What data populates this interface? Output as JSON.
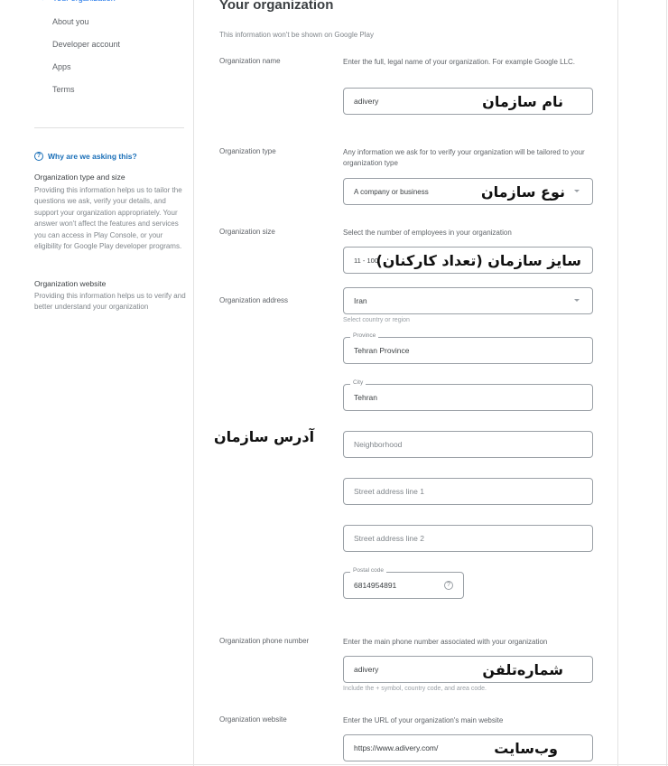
{
  "sidebar": {
    "nav": {
      "active": "Your organization",
      "items": [
        "About you",
        "Developer account",
        "Apps",
        "Terms"
      ]
    },
    "why": {
      "label": "Why are we asking this?",
      "sections": [
        {
          "heading": "Organization type and size",
          "body": "Providing this information helps us to tailor the questions we ask, verify your details, and support your organization appropriately. Your answer won't affect the features and services you can access in Play Console, or your eligibility for Google Play developer programs."
        },
        {
          "heading": "Organization website",
          "body": "Providing this information helps us to verify and better understand your organization"
        }
      ]
    }
  },
  "main": {
    "title": "Your organization",
    "subtitle": "This information won't be shown on Google Play",
    "org_name": {
      "label": "Organization name",
      "desc": "Enter the full, legal name of your organization. For example Google LLC.",
      "value": "adivery",
      "annotation": "نام سازمان"
    },
    "org_type": {
      "label": "Organization type",
      "desc": "Any information we ask for to verify your organization will be tailored to your organization type",
      "value": "A company or business",
      "annotation": "نوع سازمان"
    },
    "org_size": {
      "label": "Organization size",
      "desc": "Select the number of employees in your organization",
      "value": "11 - 100",
      "annotation": "سایز سازمان (تعداد کارکنان)"
    },
    "org_address": {
      "label": "Organization address",
      "annotation": "آدرس سازمان",
      "country": {
        "value": "Iran",
        "hint": "Select country or region"
      },
      "province": {
        "legend": "Province",
        "value": "Tehran Province"
      },
      "city": {
        "legend": "City",
        "value": "Tehran"
      },
      "neighborhood": {
        "placeholder": "Neighborhood"
      },
      "street1": {
        "placeholder": "Street address line 1"
      },
      "street2": {
        "placeholder": "Street address line 2"
      },
      "postal": {
        "legend": "Postal code",
        "value": "6814954891"
      }
    },
    "org_phone": {
      "label": "Organization phone number",
      "desc": "Enter the main phone number associated with your organization",
      "value": "adivery",
      "hint": "Include the + symbol, country code, and area code.",
      "annotation": "شماره‌تلفن"
    },
    "org_website": {
      "label": "Organization website",
      "desc": "Enter the URL of your organization's main website",
      "value": "https://www.adivery.com/",
      "annotation": "وب‌سایت"
    }
  }
}
